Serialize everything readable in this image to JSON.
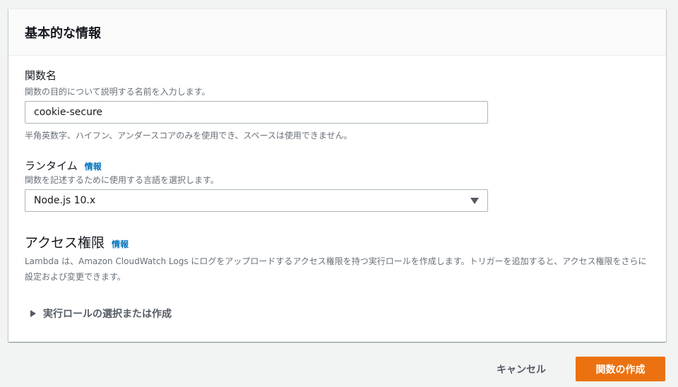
{
  "section_title": "基本的な情報",
  "function_name": {
    "label": "関数名",
    "description": "関数の目的について説明する名前を入力します。",
    "value": "cookie-secure",
    "constraint": "半角英数字、ハイフン、アンダースコアのみを使用でき、スペースは使用できません。"
  },
  "runtime": {
    "label": "ランタイム",
    "info": "情報",
    "description": "関数を記述するために使用する言語を選択します。",
    "selected": "Node.js 10.x"
  },
  "permissions": {
    "title": "アクセス権限",
    "info": "情報",
    "description": "Lambda は、Amazon CloudWatch Logs にログをアップロードするアクセス権限を持つ実行ロールを作成します。トリガーを追加すると、アクセス権限をさらに設定および変更できます。",
    "expander": "実行ロールの選択または作成"
  },
  "actions": {
    "cancel": "キャンセル",
    "create": "関数の作成"
  }
}
